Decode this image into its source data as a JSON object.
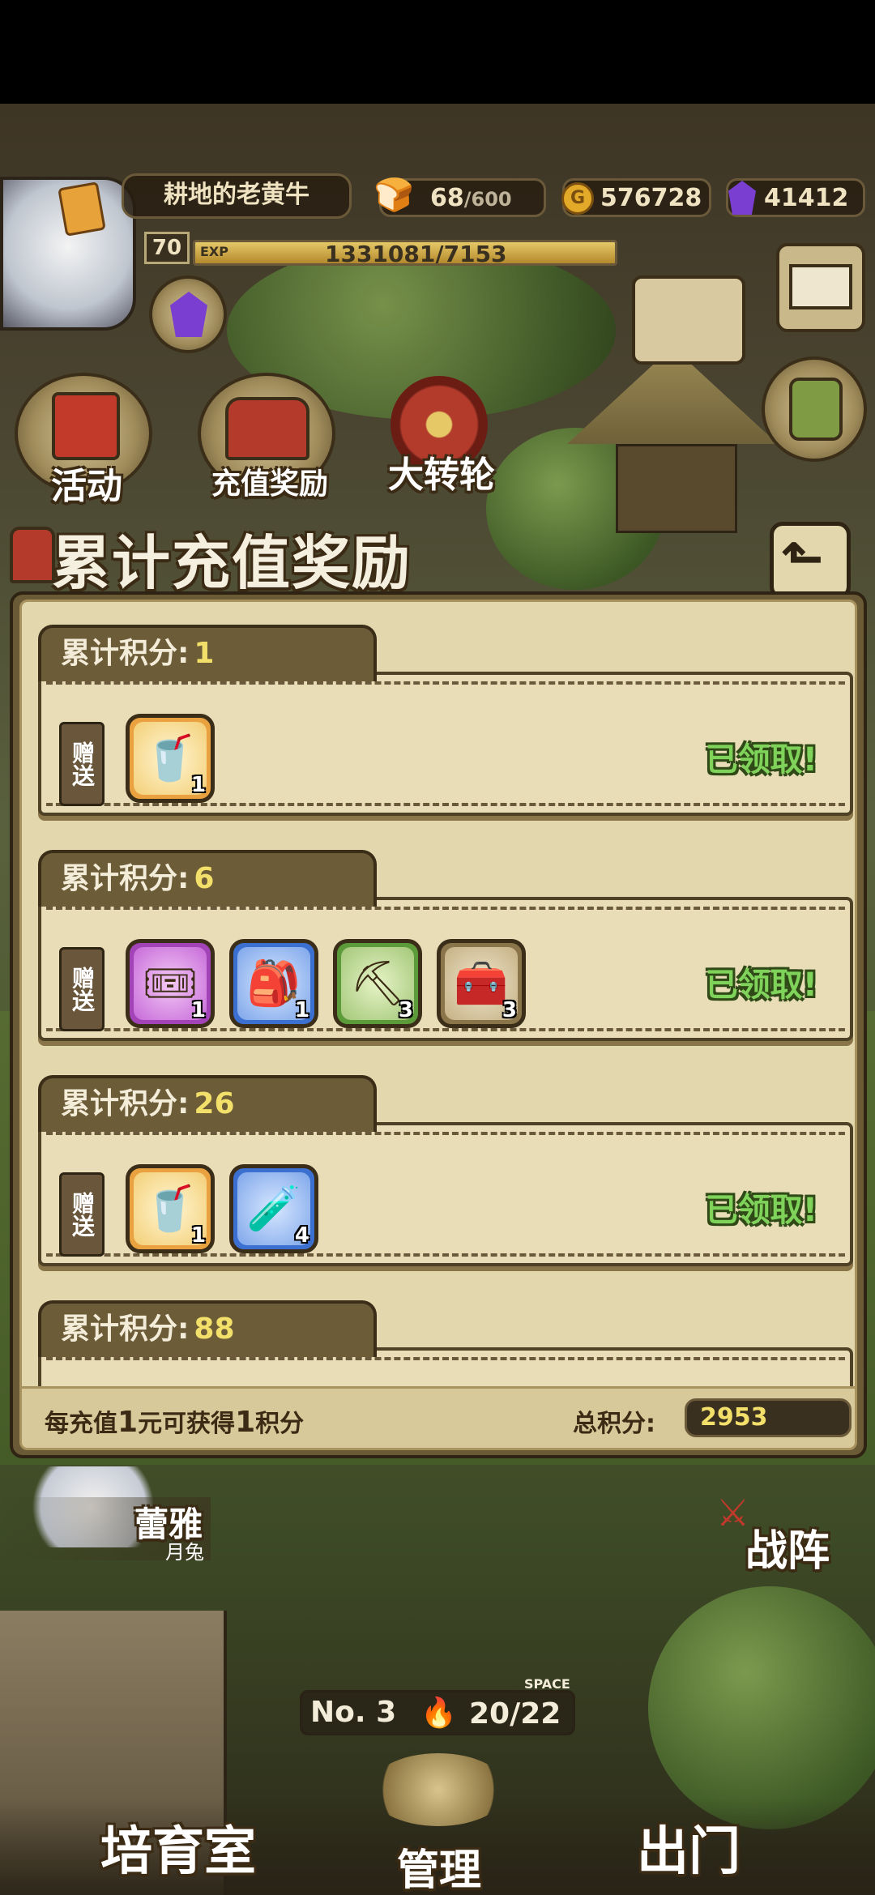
{
  "player": {
    "name": "耕地的老黄牛",
    "level": "70",
    "exp_label": "EXP",
    "exp_text": "1331081/7153"
  },
  "resources": {
    "stamina": "68",
    "stamina_max": "/600",
    "gold": "576728",
    "gems": "41412"
  },
  "top_buttons": {
    "activity": "活动",
    "recharge_reward": "充值奖励",
    "wheel": "大转轮"
  },
  "panel": {
    "title": "累计充值奖励",
    "gift_label": "赠送",
    "claimed_text": "已领取!",
    "tier_label": "累计积分:",
    "tiers": [
      {
        "points": "1",
        "items": [
          {
            "icon": "drink-cup-icon",
            "count": "1",
            "rarity": "gold"
          }
        ],
        "status": "已领取!"
      },
      {
        "points": "6",
        "items": [
          {
            "icon": "ticket-icon",
            "count": "1",
            "rarity": "purple"
          },
          {
            "icon": "bag-icon",
            "count": "1",
            "rarity": "blue"
          },
          {
            "icon": "pickaxe-icon",
            "count": "3",
            "rarity": "green"
          },
          {
            "icon": "chest-icon",
            "count": "3",
            "rarity": "brown"
          }
        ],
        "status": "已领取!"
      },
      {
        "points": "26",
        "items": [
          {
            "icon": "drink-cup-icon",
            "count": "1",
            "rarity": "gold"
          },
          {
            "icon": "green-potion-icon",
            "count": "4",
            "rarity": "blue"
          }
        ],
        "status": "已领取!"
      },
      {
        "points": "88"
      }
    ],
    "footer_note_parts": [
      "每充值",
      "1",
      "元可获得",
      "1",
      "积分"
    ],
    "total_label": "总积分:",
    "total_value": "2953"
  },
  "bottom": {
    "character_name": "蕾雅",
    "character_sub": "月兔",
    "formation": "战阵",
    "room_no": "No. 3",
    "space_label": "SPACE",
    "capacity": "20/22",
    "nursery": "培育室",
    "manage": "管理",
    "go_out": "出门"
  }
}
